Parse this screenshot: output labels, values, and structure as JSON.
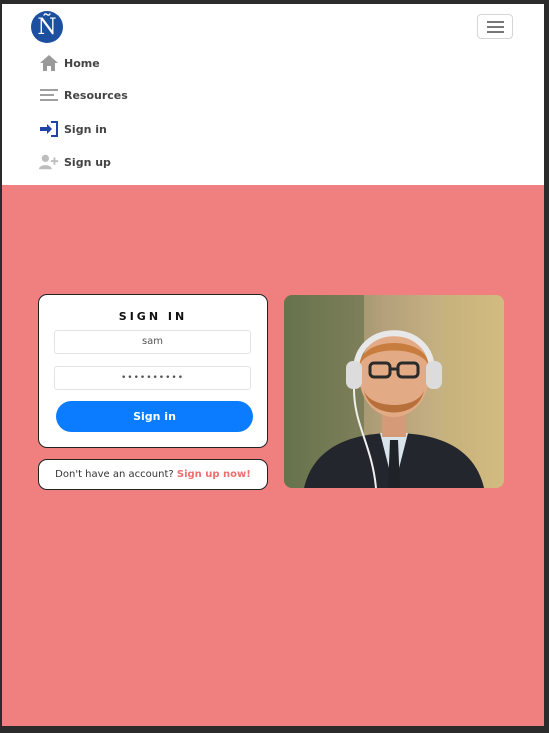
{
  "logo": {
    "letter": "Ñ"
  },
  "nav": {
    "items": [
      {
        "label": "Home",
        "icon": "home-icon"
      },
      {
        "label": "Resources",
        "icon": "list-icon"
      },
      {
        "label": "Sign in",
        "icon": "sign-in-icon"
      },
      {
        "label": "Sign up",
        "icon": "user-plus-icon"
      }
    ]
  },
  "signin": {
    "title": "SIGN IN",
    "username": "sam",
    "password_mask": "••••••••••",
    "button": "Sign in"
  },
  "signup": {
    "prompt": "Don't have an account?",
    "link": "Sign up now!"
  },
  "colors": {
    "background": "#f08080",
    "primary": "#0b7cff",
    "logo": "#1c4fa0",
    "link": "#ee6f6f"
  }
}
